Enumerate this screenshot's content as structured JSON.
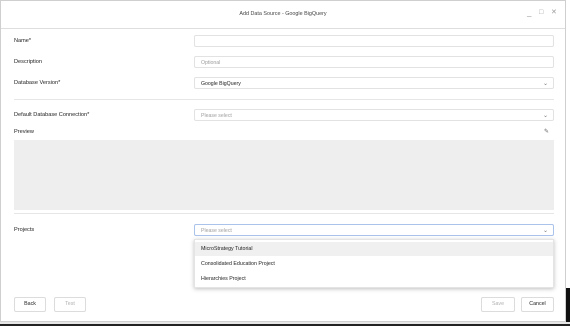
{
  "window": {
    "title": "Add Data Source - Google BigQuery",
    "minimize": "_",
    "restore": "□",
    "close": "✕"
  },
  "form": {
    "name_label": "Name*",
    "name_value": "",
    "description_label": "Description",
    "description_placeholder": "Optional",
    "db_version_label": "Database Version*",
    "db_version_value": "Google BigQuery",
    "default_conn_label": "Default Database Connection*",
    "default_conn_placeholder": "Please select",
    "preview_label": "Preview",
    "projects_label": "Projects",
    "projects_placeholder": "Please select"
  },
  "projects_dropdown": {
    "options": [
      "MicroStrategy Tutorial",
      "Consolidated Education Project",
      "Hierarchies Project"
    ],
    "highlighted_index": 0
  },
  "icons": {
    "chevron": "⌄",
    "pencil": "✎"
  },
  "footer": {
    "back_label": "Back",
    "test_label": "Test",
    "save_label": "Save",
    "cancel_label": "Cancel"
  }
}
